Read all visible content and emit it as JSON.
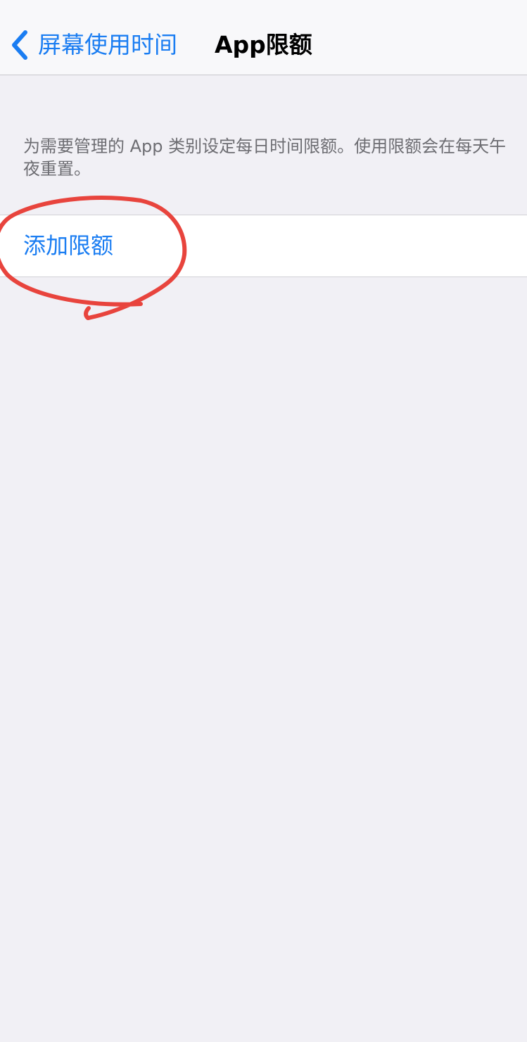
{
  "nav": {
    "back_label": "屏幕使用时间",
    "title": "App限额"
  },
  "description": "为需要管理的 App 类别设定每日时间限额。使用限额会在每天午夜重置。",
  "add_limit": {
    "label": "添加限额"
  },
  "colors": {
    "accent": "#1a7df2",
    "background": "#f1f0f5",
    "annotation": "#e8443d"
  },
  "icons": {
    "back": "chevron-left-icon"
  }
}
